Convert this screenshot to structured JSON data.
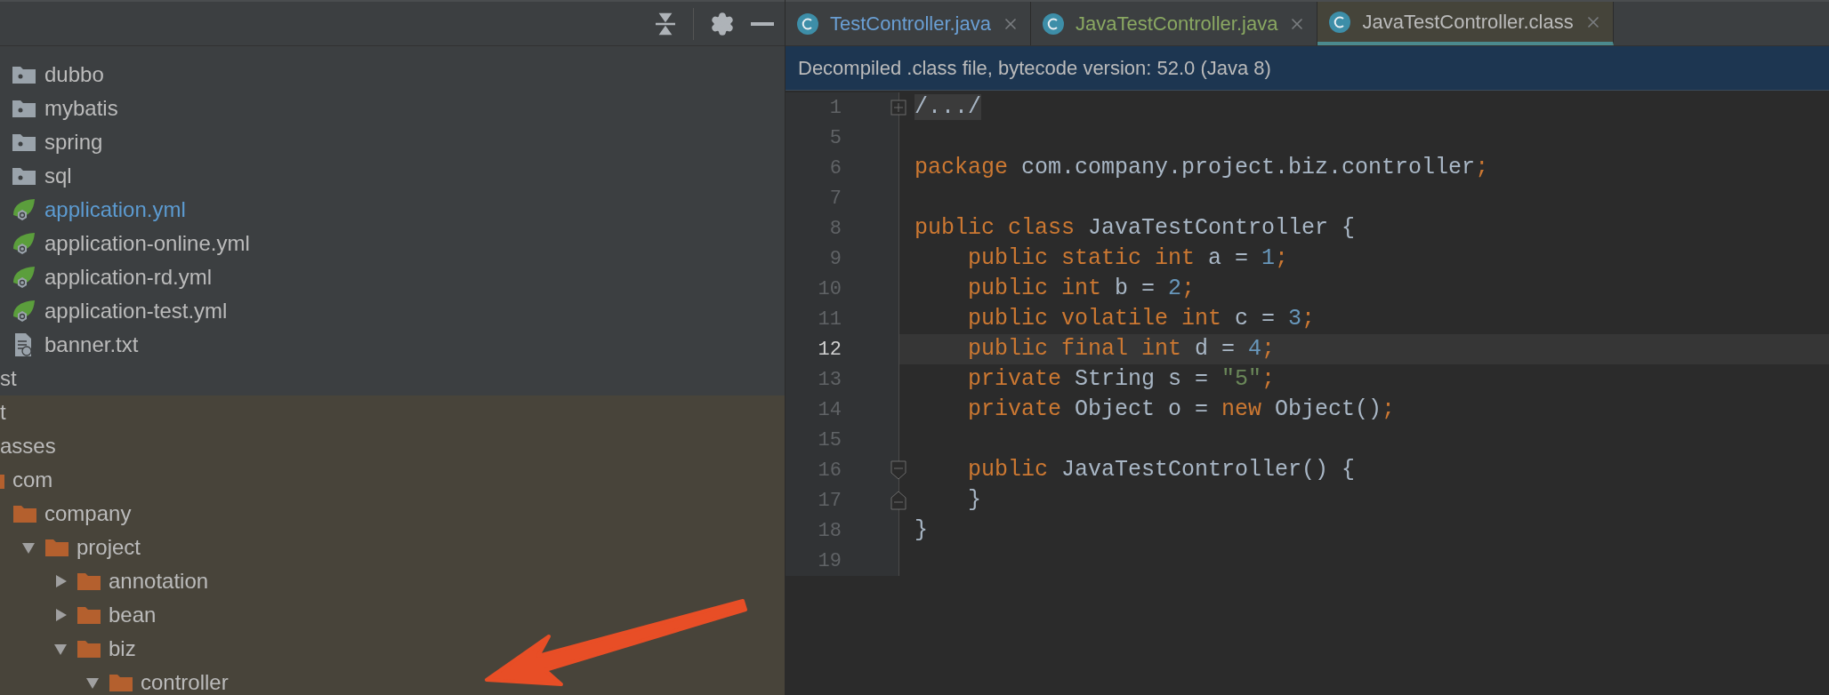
{
  "resource_files": [
    {
      "label": "dubbo",
      "kind": "resource-folder",
      "modified": false
    },
    {
      "label": "mybatis",
      "kind": "resource-folder",
      "modified": false
    },
    {
      "label": "spring",
      "kind": "resource-folder",
      "modified": false
    },
    {
      "label": "sql",
      "kind": "resource-folder",
      "modified": false
    },
    {
      "label": "application.yml",
      "kind": "spring-config",
      "modified": true
    },
    {
      "label": "application-online.yml",
      "kind": "spring-config",
      "modified": false
    },
    {
      "label": "application-rd.yml",
      "kind": "spring-config",
      "modified": false
    },
    {
      "label": "application-test.yml",
      "kind": "spring-config",
      "modified": false
    },
    {
      "label": "banner.txt",
      "kind": "text-file",
      "modified": false
    }
  ],
  "tree": [
    {
      "label": "st",
      "excluded": false
    },
    {
      "label": "t",
      "excluded": true
    },
    {
      "label": "asses",
      "excluded": true,
      "children": [
        {
          "label": "com",
          "kind": "folder",
          "excluded": true,
          "children": [
            {
              "label": "company",
              "kind": "folder",
              "excluded": true,
              "children": [
                {
                  "label": "project",
                  "kind": "folder",
                  "excluded": true,
                  "expanded": true,
                  "children": [
                    {
                      "label": "annotation",
                      "kind": "folder",
                      "excluded": true,
                      "expanded": false
                    },
                    {
                      "label": "bean",
                      "kind": "folder",
                      "excluded": true,
                      "expanded": false
                    },
                    {
                      "label": "biz",
                      "kind": "folder",
                      "excluded": true,
                      "expanded": true,
                      "children": [
                        {
                          "label": "controller",
                          "kind": "folder",
                          "excluded": true,
                          "expanded": true
                        }
                      ]
                    }
                  ]
                }
              ]
            }
          ]
        }
      ]
    }
  ],
  "tabs": [
    {
      "label": "TestController.java",
      "color": "#6a9fd4",
      "selected": false
    },
    {
      "label": "JavaTestController.java",
      "color": "#8aa862",
      "selected": false
    },
    {
      "label": "JavaTestController.class",
      "color": "#bbbbbb",
      "selected": true
    }
  ],
  "banner": "Decompiled .class file, bytecode version: 52.0 (Java 8)",
  "lines": [
    {
      "number": "1",
      "current": false,
      "kind": "fold-expand",
      "tokens": [
        {
          "kind": "folded",
          "text": "/.../"
        }
      ]
    },
    {
      "number": "5",
      "current": false,
      "kind": "plain"
    },
    {
      "number": "6",
      "current": false,
      "tokens": [
        {
          "kind": "keyword",
          "text": "package "
        },
        {
          "kind": "plain",
          "text": "com.company.project.biz.controller"
        },
        {
          "kind": "keyword",
          "text": ";"
        }
      ]
    },
    {
      "number": "7",
      "current": false,
      "kind": "plain"
    },
    {
      "number": "8",
      "current": false,
      "tokens": [
        {
          "kind": "keyword",
          "text": "public class "
        },
        {
          "kind": "plain",
          "text": "JavaTestController {"
        }
      ]
    },
    {
      "number": "9",
      "current": false,
      "tokens": [
        {
          "kind": "keyword",
          "text": "    public static int "
        },
        {
          "kind": "plain",
          "text": "a = "
        },
        {
          "kind": "number",
          "text": "1"
        },
        {
          "kind": "keyword",
          "text": ";"
        }
      ]
    },
    {
      "number": "10",
      "current": false,
      "tokens": [
        {
          "kind": "keyword",
          "text": "    public int "
        },
        {
          "kind": "plain",
          "text": "b = "
        },
        {
          "kind": "number",
          "text": "2"
        },
        {
          "kind": "keyword",
          "text": ";"
        }
      ]
    },
    {
      "number": "11",
      "current": false,
      "tokens": [
        {
          "kind": "keyword",
          "text": "    public volatile int "
        },
        {
          "kind": "plain",
          "text": "c = "
        },
        {
          "kind": "number",
          "text": "3"
        },
        {
          "kind": "keyword",
          "text": ";"
        }
      ]
    },
    {
      "number": "12",
      "current": true,
      "tokens": [
        {
          "kind": "keyword",
          "text": "    public final int "
        },
        {
          "kind": "plain",
          "text": "d = "
        },
        {
          "kind": "number",
          "text": "4"
        },
        {
          "kind": "keyword",
          "text": ";"
        }
      ]
    },
    {
      "number": "13",
      "current": false,
      "tokens": [
        {
          "kind": "keyword",
          "text": "    private "
        },
        {
          "kind": "plain",
          "text": "String s = "
        },
        {
          "kind": "string",
          "text": "\"5\""
        },
        {
          "kind": "keyword",
          "text": ";"
        }
      ]
    },
    {
      "number": "14",
      "current": false,
      "tokens": [
        {
          "kind": "keyword",
          "text": "    private "
        },
        {
          "kind": "plain",
          "text": "Object o = "
        },
        {
          "kind": "keyword",
          "text": "new "
        },
        {
          "kind": "plain",
          "text": "Object()"
        },
        {
          "kind": "keyword",
          "text": ";"
        }
      ]
    },
    {
      "number": "15",
      "current": false,
      "kind": "plain"
    },
    {
      "number": "16",
      "current": false,
      "kind": "fold-start",
      "tokens": [
        {
          "kind": "keyword",
          "text": "    public "
        },
        {
          "kind": "plain",
          "text": "JavaTestController() {"
        }
      ]
    },
    {
      "number": "17",
      "current": false,
      "kind": "fold-end",
      "tokens": [
        {
          "kind": "plain",
          "text": "    }"
        }
      ]
    },
    {
      "number": "18",
      "current": false,
      "tokens": [
        {
          "kind": "plain",
          "text": "}"
        }
      ]
    },
    {
      "number": "19",
      "current": false,
      "kind": "plain"
    }
  ]
}
